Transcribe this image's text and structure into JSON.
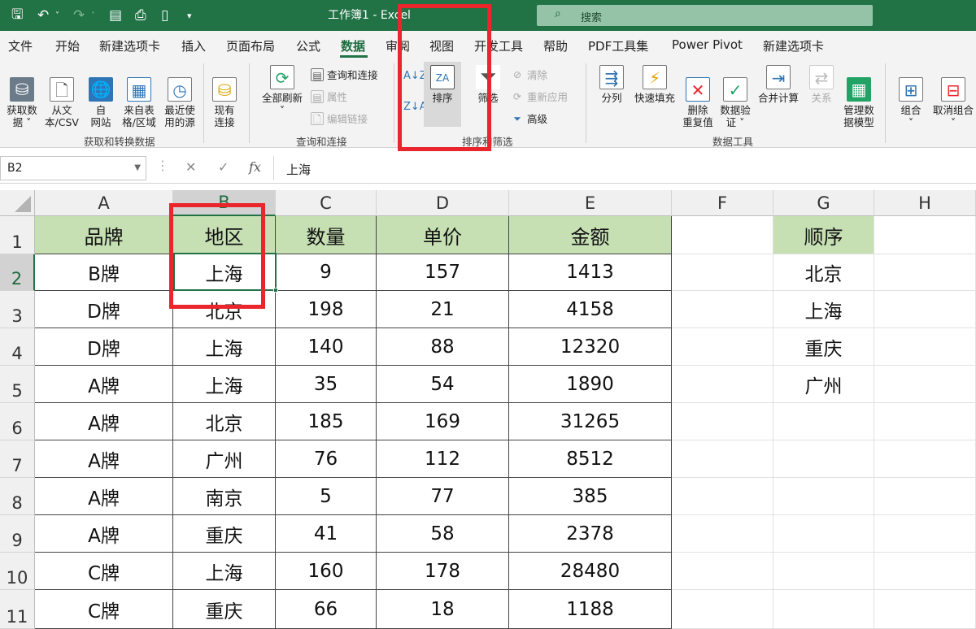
{
  "titlebar": {
    "title": "工作簿1  -  Excel",
    "search_placeholder": "搜索",
    "save_icon": "save-icon",
    "undo_icon": "undo-icon",
    "redo_icon": "redo-icon"
  },
  "menu": {
    "tabs": [
      "文件",
      "开始",
      "新建选项卡",
      "插入",
      "页面布局",
      "公式",
      "数据",
      "审阅",
      "视图",
      "开发工具",
      "帮助",
      "PDF工具集",
      "Power Pivot",
      "新建选项卡"
    ],
    "active": "数据"
  },
  "ribbon": {
    "get_data": {
      "get_data": "获取数\n据 ˅",
      "from_csv": "从文\n本/CSV",
      "from_web": "自\n网站",
      "from_table": "来自表\n格/区域",
      "recent": "最近使\n用的源",
      "existing": "现有\n连接",
      "group": "获取和转换数据"
    },
    "queries": {
      "refresh_all": "全部刷新",
      "queries_connections": "查询和连接",
      "properties": "属性",
      "edit_links": "编辑链接",
      "group": "查询和连接"
    },
    "sort_filter": {
      "sort": "排序",
      "filter": "筛选",
      "clear": "清除",
      "reapply": "重新应用",
      "advanced": "高级",
      "group": "排序和筛选"
    },
    "data_tools": {
      "text_to_columns": "分列",
      "flash_fill": "快速填充",
      "remove_duplicates": "删除\n重复值",
      "data_validation": "数据验\n证 ˅",
      "consolidate": "合并计算",
      "relationships": "关系",
      "data_model": "管理数\n据模型",
      "group": "数据工具"
    },
    "outline": {
      "group": "组合\n˅",
      "ungroup": "取消组合\n˅"
    }
  },
  "formula_bar": {
    "name_box": "B2",
    "cancel": "✕",
    "enter": "✓",
    "fx": "fx",
    "content": "上海"
  },
  "sheet": {
    "columns": [
      "A",
      "B",
      "C",
      "D",
      "E",
      "F",
      "G",
      "H"
    ],
    "rows": [
      "1",
      "2",
      "3",
      "4",
      "5",
      "6",
      "7",
      "8",
      "9",
      "10",
      "11"
    ],
    "header": [
      "品牌",
      "地区",
      "数量",
      "单价",
      "金额"
    ],
    "data": [
      [
        "B牌",
        "上海",
        "9",
        "157",
        "1413"
      ],
      [
        "D牌",
        "北京",
        "198",
        "21",
        "4158"
      ],
      [
        "D牌",
        "上海",
        "140",
        "88",
        "12320"
      ],
      [
        "A牌",
        "上海",
        "35",
        "54",
        "1890"
      ],
      [
        "A牌",
        "北京",
        "185",
        "169",
        "31265"
      ],
      [
        "A牌",
        "广州",
        "76",
        "112",
        "8512"
      ],
      [
        "A牌",
        "南京",
        "5",
        "77",
        "385"
      ],
      [
        "A牌",
        "重庆",
        "41",
        "58",
        "2378"
      ],
      [
        "C牌",
        "上海",
        "160",
        "178",
        "28480"
      ],
      [
        "C牌",
        "重庆",
        "66",
        "18",
        "1188"
      ]
    ],
    "order_header": "顺序",
    "order": [
      "北京",
      "上海",
      "重庆",
      "广州"
    ],
    "header_fill": "#c6e0b4",
    "accent": "#217346",
    "annotation": "#e8262b"
  }
}
